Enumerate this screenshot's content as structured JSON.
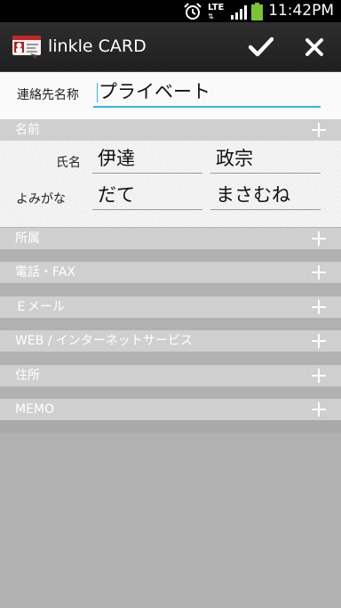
{
  "status_bar": {
    "time": "11:42PM",
    "network": "LTE",
    "icons": [
      "alarm-icon",
      "lte-icon",
      "signal-icon",
      "battery-icon"
    ]
  },
  "action_bar": {
    "title": "linkle CARD",
    "confirm_icon": "checkmark-icon",
    "cancel_icon": "close-icon"
  },
  "form": {
    "contact_name_label": "連絡先名称",
    "contact_name_value": "プライベート",
    "name_section": {
      "title": "名前",
      "full_name_label": "氏名",
      "last_name": "伊達",
      "first_name": "政宗",
      "reading_label": "よみがな",
      "last_name_reading": "だて",
      "first_name_reading": "まさむね"
    },
    "sections": [
      {
        "title": "所属"
      },
      {
        "title": "電話・FAX"
      },
      {
        "title": "Ｅメール"
      },
      {
        "title": "WEB / インターネットサービス"
      },
      {
        "title": "住所"
      },
      {
        "title": "MEMO"
      }
    ]
  },
  "colors": {
    "accent": "#33b5e5",
    "action_bar": "#262626",
    "section_header": "#cfcfcf",
    "background": "#b1b1b1"
  }
}
